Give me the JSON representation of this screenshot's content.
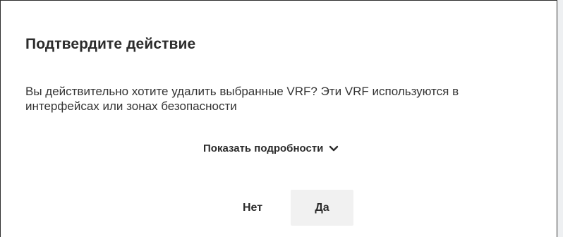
{
  "dialog": {
    "title": "Подтвердите действие",
    "message": "Вы действительно хотите удалить выбранные VRF? Эти VRF используются в интерфейсах или зонах безопасности",
    "details_toggle": {
      "label": "Показать подробности",
      "icon": "chevron-down-icon"
    },
    "buttons": {
      "no_label": "Нет",
      "yes_label": "Да"
    }
  }
}
